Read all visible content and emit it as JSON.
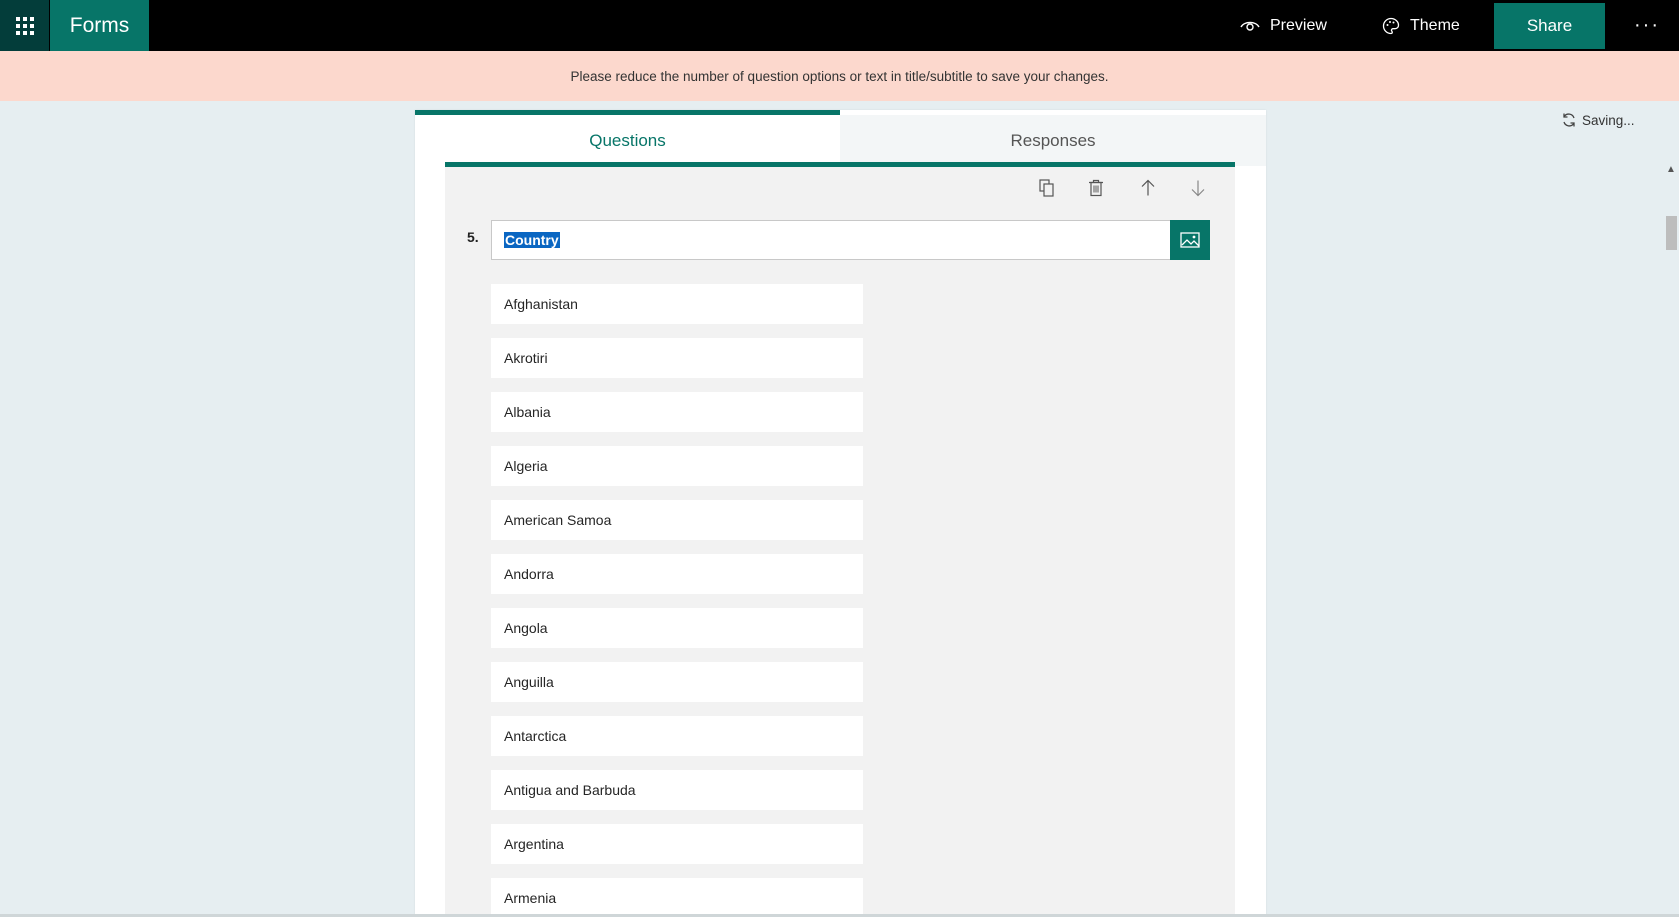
{
  "header": {
    "app_name": "Forms",
    "waffle_icon": "app-launcher-icon",
    "preview_label": "Preview",
    "theme_label": "Theme",
    "share_label": "Share",
    "more_label": "···"
  },
  "banner": {
    "message": "Please reduce the number of question options or text in title/subtitle to save your changes."
  },
  "status": {
    "saving_text": "Saving..."
  },
  "tabs": [
    {
      "label": "Questions",
      "active": true
    },
    {
      "label": "Responses",
      "active": false
    }
  ],
  "question": {
    "number": "5.",
    "title": "Country",
    "toolbar_icons": [
      "copy-icon",
      "delete-icon",
      "move-up-icon",
      "move-down-icon"
    ],
    "options": [
      "Afghanistan",
      "Akrotiri",
      "Albania",
      "Algeria",
      "American Samoa",
      "Andorra",
      "Angola",
      "Anguilla",
      "Antarctica",
      "Antigua and Barbuda",
      "Argentina",
      "Armenia"
    ]
  },
  "colors": {
    "accent": "#077568",
    "banner_bg": "#fcd8cd",
    "page_bg": "#e6eef1",
    "selection": "#0a66c2"
  }
}
